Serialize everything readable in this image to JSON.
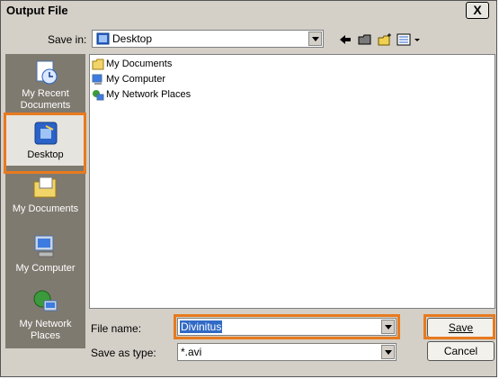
{
  "window": {
    "title": "Output File",
    "close_glyph": "X"
  },
  "save_in": {
    "label": "Save in:",
    "value": "Desktop"
  },
  "toolbar": {
    "icons": [
      "back-arrow-icon",
      "up-folder-icon",
      "new-folder-icon",
      "view-menu-icon"
    ]
  },
  "places": [
    {
      "label": "My Recent Documents",
      "icon": "recent-documents-icon"
    },
    {
      "label": "Desktop",
      "icon": "desktop-icon",
      "selected": true
    },
    {
      "label": "My Documents",
      "icon": "my-documents-icon"
    },
    {
      "label": "My Computer",
      "icon": "my-computer-icon"
    },
    {
      "label": "My Network Places",
      "icon": "network-places-icon"
    }
  ],
  "files": [
    {
      "name": "My Documents",
      "icon": "folder-icon"
    },
    {
      "name": "My Computer",
      "icon": "computer-icon"
    },
    {
      "name": "My Network Places",
      "icon": "network-icon"
    }
  ],
  "file_name": {
    "label": "File name:",
    "value": "Divinitus"
  },
  "save_as_type": {
    "label": "Save as type:",
    "value": "*.avi"
  },
  "buttons": {
    "save": "Save",
    "cancel": "Cancel"
  },
  "colors": {
    "highlight": "#e87a1e",
    "dialog_bg": "#d4d0c8",
    "sidebar_bg": "#7f7a70"
  }
}
